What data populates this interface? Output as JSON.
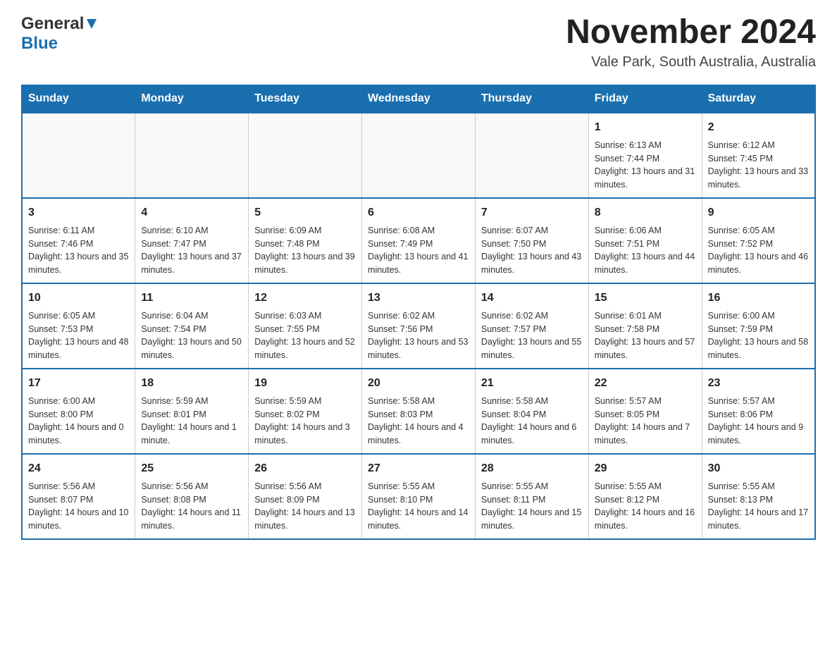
{
  "header": {
    "logo_general": "General",
    "logo_blue": "Blue",
    "month_title": "November 2024",
    "location": "Vale Park, South Australia, Australia"
  },
  "days_of_week": [
    "Sunday",
    "Monday",
    "Tuesday",
    "Wednesday",
    "Thursday",
    "Friday",
    "Saturday"
  ],
  "weeks": [
    [
      {
        "day": "",
        "info": ""
      },
      {
        "day": "",
        "info": ""
      },
      {
        "day": "",
        "info": ""
      },
      {
        "day": "",
        "info": ""
      },
      {
        "day": "",
        "info": ""
      },
      {
        "day": "1",
        "info": "Sunrise: 6:13 AM\nSunset: 7:44 PM\nDaylight: 13 hours and 31 minutes."
      },
      {
        "day": "2",
        "info": "Sunrise: 6:12 AM\nSunset: 7:45 PM\nDaylight: 13 hours and 33 minutes."
      }
    ],
    [
      {
        "day": "3",
        "info": "Sunrise: 6:11 AM\nSunset: 7:46 PM\nDaylight: 13 hours and 35 minutes."
      },
      {
        "day": "4",
        "info": "Sunrise: 6:10 AM\nSunset: 7:47 PM\nDaylight: 13 hours and 37 minutes."
      },
      {
        "day": "5",
        "info": "Sunrise: 6:09 AM\nSunset: 7:48 PM\nDaylight: 13 hours and 39 minutes."
      },
      {
        "day": "6",
        "info": "Sunrise: 6:08 AM\nSunset: 7:49 PM\nDaylight: 13 hours and 41 minutes."
      },
      {
        "day": "7",
        "info": "Sunrise: 6:07 AM\nSunset: 7:50 PM\nDaylight: 13 hours and 43 minutes."
      },
      {
        "day": "8",
        "info": "Sunrise: 6:06 AM\nSunset: 7:51 PM\nDaylight: 13 hours and 44 minutes."
      },
      {
        "day": "9",
        "info": "Sunrise: 6:05 AM\nSunset: 7:52 PM\nDaylight: 13 hours and 46 minutes."
      }
    ],
    [
      {
        "day": "10",
        "info": "Sunrise: 6:05 AM\nSunset: 7:53 PM\nDaylight: 13 hours and 48 minutes."
      },
      {
        "day": "11",
        "info": "Sunrise: 6:04 AM\nSunset: 7:54 PM\nDaylight: 13 hours and 50 minutes."
      },
      {
        "day": "12",
        "info": "Sunrise: 6:03 AM\nSunset: 7:55 PM\nDaylight: 13 hours and 52 minutes."
      },
      {
        "day": "13",
        "info": "Sunrise: 6:02 AM\nSunset: 7:56 PM\nDaylight: 13 hours and 53 minutes."
      },
      {
        "day": "14",
        "info": "Sunrise: 6:02 AM\nSunset: 7:57 PM\nDaylight: 13 hours and 55 minutes."
      },
      {
        "day": "15",
        "info": "Sunrise: 6:01 AM\nSunset: 7:58 PM\nDaylight: 13 hours and 57 minutes."
      },
      {
        "day": "16",
        "info": "Sunrise: 6:00 AM\nSunset: 7:59 PM\nDaylight: 13 hours and 58 minutes."
      }
    ],
    [
      {
        "day": "17",
        "info": "Sunrise: 6:00 AM\nSunset: 8:00 PM\nDaylight: 14 hours and 0 minutes."
      },
      {
        "day": "18",
        "info": "Sunrise: 5:59 AM\nSunset: 8:01 PM\nDaylight: 14 hours and 1 minute."
      },
      {
        "day": "19",
        "info": "Sunrise: 5:59 AM\nSunset: 8:02 PM\nDaylight: 14 hours and 3 minutes."
      },
      {
        "day": "20",
        "info": "Sunrise: 5:58 AM\nSunset: 8:03 PM\nDaylight: 14 hours and 4 minutes."
      },
      {
        "day": "21",
        "info": "Sunrise: 5:58 AM\nSunset: 8:04 PM\nDaylight: 14 hours and 6 minutes."
      },
      {
        "day": "22",
        "info": "Sunrise: 5:57 AM\nSunset: 8:05 PM\nDaylight: 14 hours and 7 minutes."
      },
      {
        "day": "23",
        "info": "Sunrise: 5:57 AM\nSunset: 8:06 PM\nDaylight: 14 hours and 9 minutes."
      }
    ],
    [
      {
        "day": "24",
        "info": "Sunrise: 5:56 AM\nSunset: 8:07 PM\nDaylight: 14 hours and 10 minutes."
      },
      {
        "day": "25",
        "info": "Sunrise: 5:56 AM\nSunset: 8:08 PM\nDaylight: 14 hours and 11 minutes."
      },
      {
        "day": "26",
        "info": "Sunrise: 5:56 AM\nSunset: 8:09 PM\nDaylight: 14 hours and 13 minutes."
      },
      {
        "day": "27",
        "info": "Sunrise: 5:55 AM\nSunset: 8:10 PM\nDaylight: 14 hours and 14 minutes."
      },
      {
        "day": "28",
        "info": "Sunrise: 5:55 AM\nSunset: 8:11 PM\nDaylight: 14 hours and 15 minutes."
      },
      {
        "day": "29",
        "info": "Sunrise: 5:55 AM\nSunset: 8:12 PM\nDaylight: 14 hours and 16 minutes."
      },
      {
        "day": "30",
        "info": "Sunrise: 5:55 AM\nSunset: 8:13 PM\nDaylight: 14 hours and 17 minutes."
      }
    ]
  ]
}
